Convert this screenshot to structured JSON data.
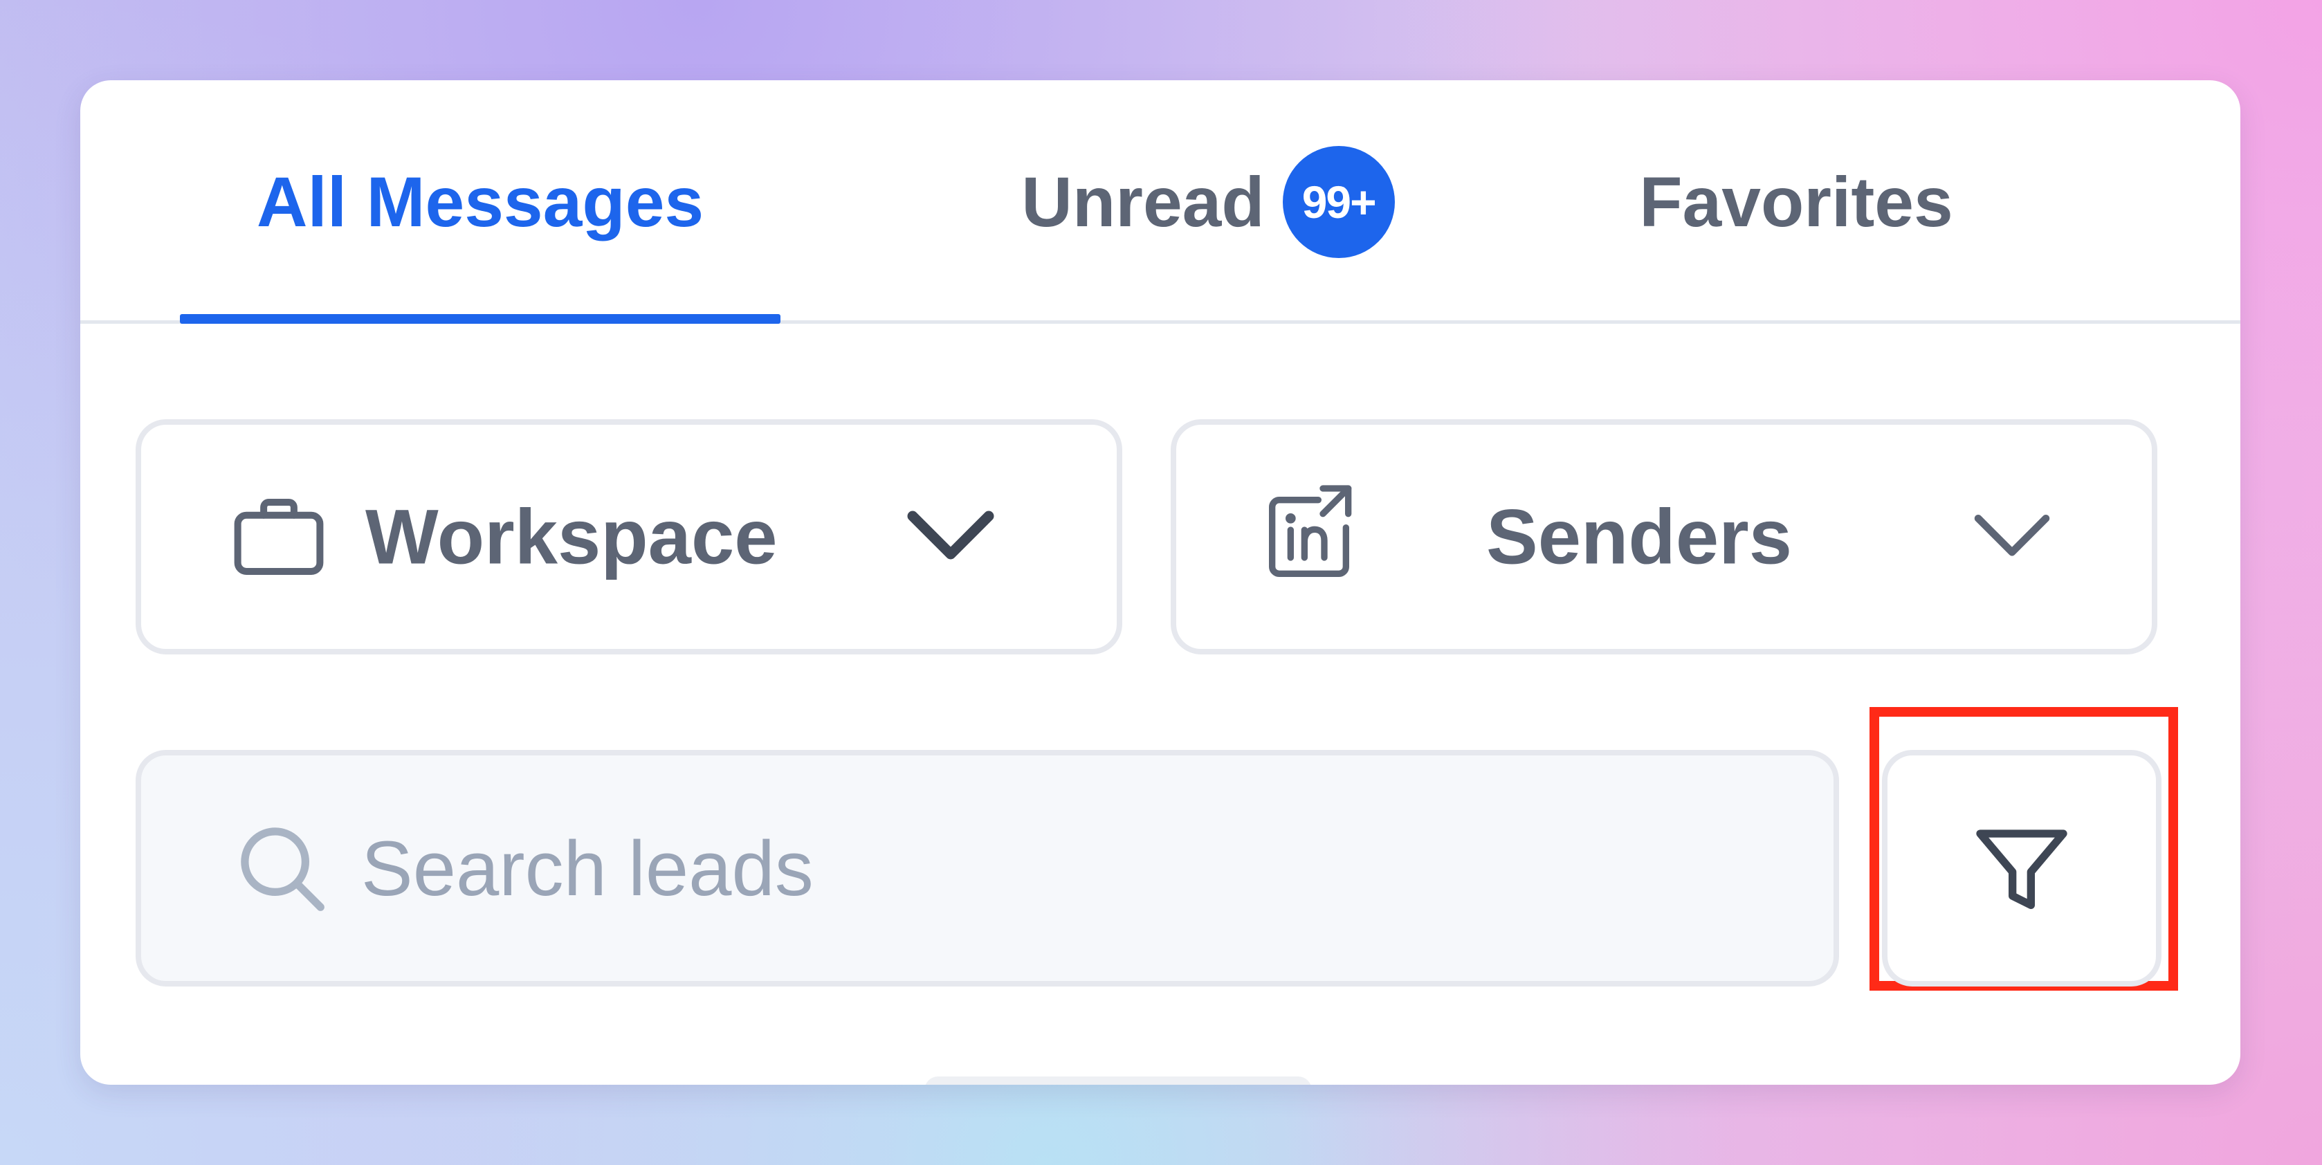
{
  "tabs": {
    "all_messages": "All Messages",
    "unread": "Unread",
    "unread_badge": "99+",
    "favorites": "Favorites",
    "active": "All Messages"
  },
  "filters": {
    "workspace_label": "Workspace",
    "workspace_icon": "briefcase-icon",
    "senders_label": "Senders",
    "senders_icon": "linkedin-share-icon"
  },
  "search": {
    "placeholder": "Search leads",
    "value": ""
  },
  "filter_button": {
    "icon": "filter-funnel-icon",
    "highlighted": true
  },
  "colors": {
    "accent": "#1d65ec",
    "highlight": "#ff2a17",
    "text": "#5d6575",
    "placeholder": "#9aa5b7"
  }
}
